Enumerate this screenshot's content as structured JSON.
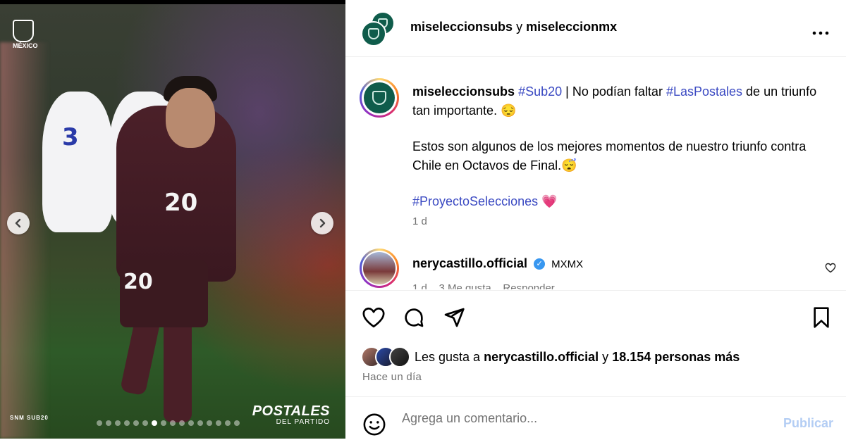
{
  "post_image": {
    "jersey_number": "20",
    "brand_tag": "SNM SUB20",
    "overlay_title": "POSTALES",
    "overlay_subtitle": "DEL PARTIDO",
    "logo_text": "MÉXICO",
    "carousel": {
      "total": 16,
      "active_index": 6
    }
  },
  "header": {
    "account_1": "miseleccionsubs",
    "joiner": "y",
    "account_2": "miseleccionmx",
    "more_icon": "more-horizontal-icon"
  },
  "caption": {
    "username": "miseleccionsubs",
    "tag_1": "#Sub20",
    "text_1": "| No podían faltar",
    "tag_2": "#LasPostales",
    "text_2": "de un triunfo tan importante. 😔",
    "paragraph_2": "Estos son algunos de los mejores momentos de nuestro triunfo contra Chile en Octavos de Final.😴",
    "tag_3": "#ProyectoSelecciones",
    "tag_3_emoji": "💗",
    "time": "1 d"
  },
  "comment": {
    "username": "nerycastillo.official",
    "text": "MXMX",
    "time": "1 d",
    "likes": "3 Me gusta",
    "reply": "Responder"
  },
  "likes": {
    "prefix": "Les gusta a",
    "user": "nerycastillo.official",
    "joiner": "y",
    "count": "18.154 personas más",
    "ago": "Hace un día"
  },
  "comment_input": {
    "placeholder": "Agrega un comentario...",
    "publish": "Publicar"
  },
  "colors": {
    "link": "#3a49c2",
    "publish_disabled": "#b3cdf4",
    "brand_green": "#0f5c4b"
  }
}
